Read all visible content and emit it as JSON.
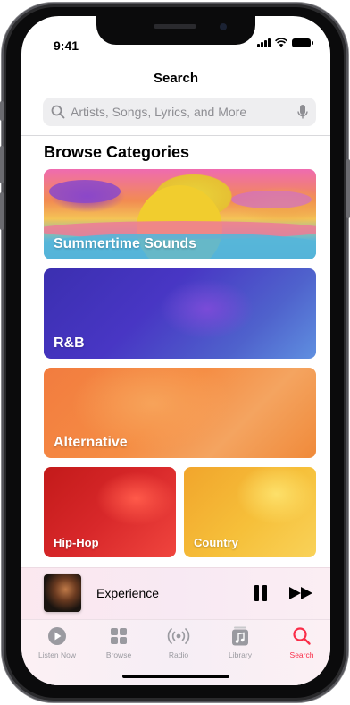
{
  "status_bar": {
    "time": "9:41"
  },
  "header": {
    "title": "Search",
    "search_placeholder": "Artists, Songs, Lyrics, and More"
  },
  "browse": {
    "title": "Browse Categories",
    "categories": [
      {
        "label": "Summertime Sounds"
      },
      {
        "label": "R&B"
      },
      {
        "label": "Alternative"
      },
      {
        "label": "Hip-Hop"
      },
      {
        "label": "Country"
      }
    ]
  },
  "now_playing": {
    "title": "Experience"
  },
  "tab_bar": {
    "items": [
      {
        "label": "Listen Now",
        "icon": "play-circle-icon"
      },
      {
        "label": "Browse",
        "icon": "grid-icon"
      },
      {
        "label": "Radio",
        "icon": "radio-waves-icon"
      },
      {
        "label": "Library",
        "icon": "music-note-icon"
      },
      {
        "label": "Search",
        "icon": "search-icon"
      }
    ],
    "active": "Search"
  },
  "colors": {
    "accent": "#fa2d48",
    "tab_inactive": "#9a9aa0"
  }
}
